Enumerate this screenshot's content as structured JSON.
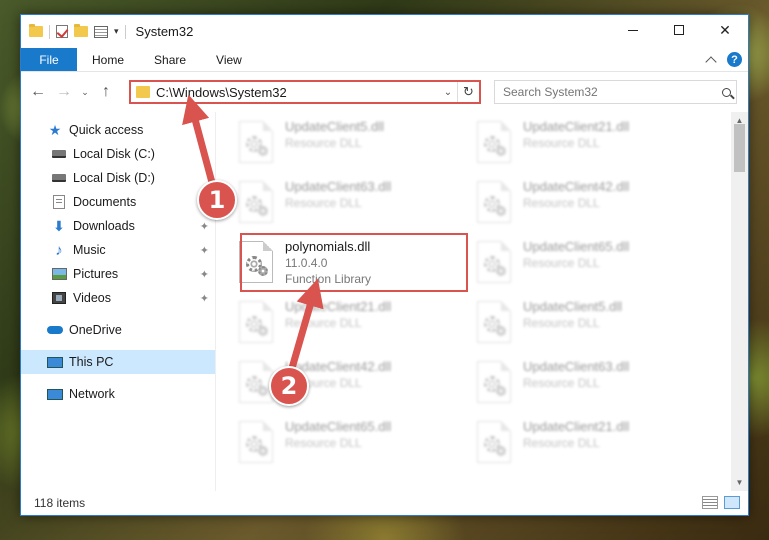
{
  "window": {
    "title": "System32",
    "minimize_glyph": "",
    "maximize_glyph": "",
    "close_glyph": "✕"
  },
  "ribbon": {
    "tabs": [
      {
        "label": "File"
      },
      {
        "label": "Home"
      },
      {
        "label": "Share"
      },
      {
        "label": "View"
      }
    ],
    "help_glyph": "?"
  },
  "navigation": {
    "back_glyph": "←",
    "forward_glyph": "→",
    "recent_glyph": "⌄",
    "up_glyph": "↑",
    "address_path": "C:\\Windows\\System32",
    "address_dropdown_glyph": "⌄",
    "refresh_glyph": "↻",
    "search_placeholder": "Search System32"
  },
  "sidebar": {
    "items": [
      {
        "label": "Quick access",
        "icon": "star-icon"
      },
      {
        "label": "Local Disk (C:)",
        "icon": "disk-icon"
      },
      {
        "label": "Local Disk (D:)",
        "icon": "disk-icon"
      },
      {
        "label": "Documents",
        "icon": "documents-icon"
      },
      {
        "label": "Downloads",
        "icon": "downloads-icon",
        "pinned": true
      },
      {
        "label": "Music",
        "icon": "music-icon",
        "pinned": true
      },
      {
        "label": "Pictures",
        "icon": "pictures-icon",
        "pinned": true
      },
      {
        "label": "Videos",
        "icon": "videos-icon",
        "pinned": true
      },
      {
        "label": "OneDrive",
        "icon": "onedrive-icon"
      },
      {
        "label": "This PC",
        "icon": "this-pc-icon",
        "selected": true
      },
      {
        "label": "Network",
        "icon": "network-icon"
      }
    ],
    "pin_glyph": "📌"
  },
  "files": [
    {
      "name": "UpdateClient5.dll",
      "line2": "Resource DLL",
      "line3": ""
    },
    {
      "name": "UpdateClient21.dll",
      "line2": "Resource DLL",
      "line3": ""
    },
    {
      "name": "UpdateClient63.dll",
      "line2": "Resource DLL",
      "line3": ""
    },
    {
      "name": "UpdateClient42.dll",
      "line2": "Resource DLL",
      "line3": ""
    },
    {
      "name": "polynomials.dll",
      "line2": "11.0.4.0",
      "line3": "Function Library",
      "highlighted": true
    },
    {
      "name": "UpdateClient65.dll",
      "line2": "Resource DLL",
      "line3": ""
    },
    {
      "name": "UpdateClient21.dll",
      "line2": "Resource DLL",
      "line3": ""
    },
    {
      "name": "UpdateClient5.dll",
      "line2": "Resource DLL",
      "line3": ""
    },
    {
      "name": "UpdateClient42.dll",
      "line2": "Resource DLL",
      "line3": ""
    },
    {
      "name": "UpdateClient63.dll",
      "line2": "Resource DLL",
      "line3": ""
    },
    {
      "name": "UpdateClient65.dll",
      "line2": "Resource DLL",
      "line3": ""
    },
    {
      "name": "UpdateClient21.dll",
      "line2": "Resource DLL",
      "line3": ""
    }
  ],
  "scrollbar": {
    "up_glyph": "▲",
    "down_glyph": "▼"
  },
  "status": {
    "item_count": "118 items"
  },
  "annotations": {
    "badge_1": "1",
    "badge_2": "2",
    "accent_color": "#d9534f"
  }
}
